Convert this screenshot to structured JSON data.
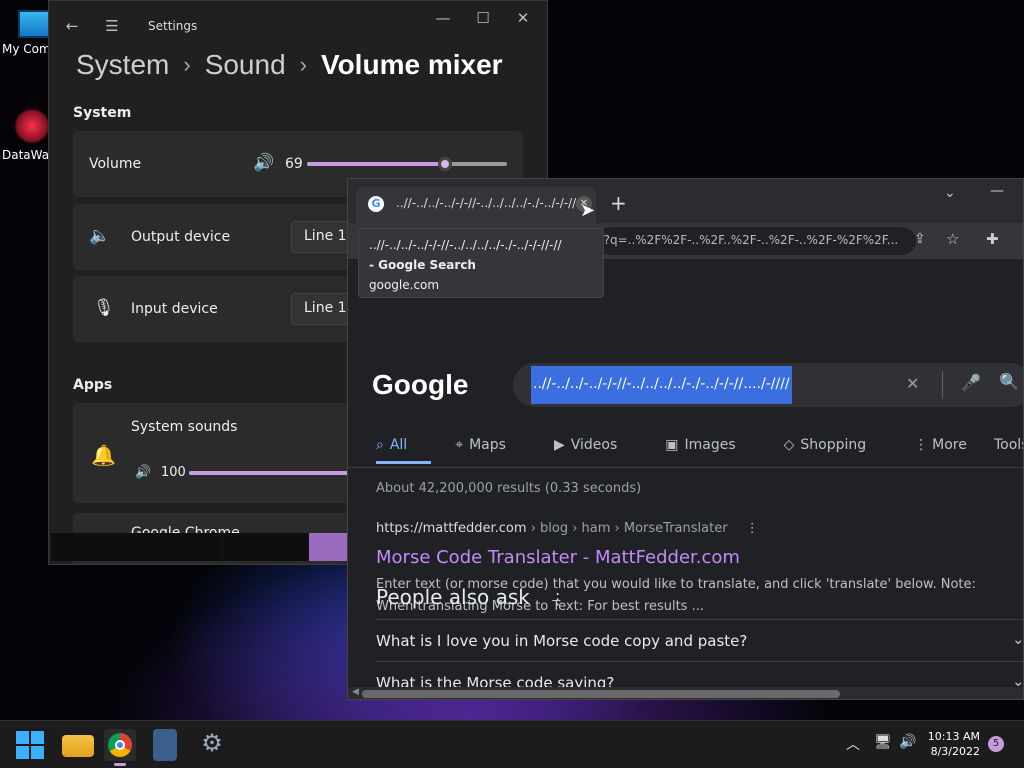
{
  "desktop": {
    "icons": [
      {
        "label": "My Com"
      },
      {
        "label": "DataWag"
      }
    ]
  },
  "settings": {
    "title": "Settings",
    "breadcrumb": [
      "System",
      "Sound",
      "Volume mixer"
    ],
    "system_heading": "System",
    "volume": {
      "label": "Volume",
      "value": "69",
      "level": 0.69
    },
    "output": {
      "label": "Output device",
      "value": "Line 1 ("
    },
    "input": {
      "label": "Input device",
      "value": "Line 1 ("
    },
    "apps_heading": "Apps",
    "system_sounds": {
      "label": "System sounds",
      "value": "100",
      "level": 1.0
    },
    "chrome_app": {
      "label": "Google Chrome"
    }
  },
  "chrome": {
    "tab_title": "..//-../../-../-/-//-../../../../-./-../-/-//..",
    "url": "n?q=..%2F%2F-..%2F..%2F-..%2F-..%2F-%2F%2F...",
    "tooltip": {
      "line1": "..//-../../-../-/-//-../../../../-./-../-/-//-//",
      "line2": "- Google Search",
      "line3": "google.com"
    },
    "logo": "Google",
    "query": "..//-../../-../-/-//-../../../../-./-../-/-//..../-////",
    "tabs": [
      "All",
      "Maps",
      "Videos",
      "Images",
      "Shopping",
      "More"
    ],
    "tools": "Tools",
    "stats": "About 42,200,000 results (0.33 seconds)",
    "result": {
      "breadcrumb": "https://mattfedder.com",
      "breadcrumb_path": " › blog › ham › MorseTranslater",
      "title": "Morse Code Translater - MattFedder.com",
      "snippet1": "Enter text (or morse code) that you would like to translate, and click 'translate' below. Note:",
      "snippet2": "When translating Morse to Text: For best results ..."
    },
    "paa_title": "People also ask",
    "paa": [
      "What is I love you in Morse code copy and paste?",
      "What is the Morse code saying?"
    ]
  },
  "taskbar": {
    "time": "10:13 AM",
    "date": "8/3/2022",
    "badge": "5"
  },
  "colors": {
    "accent": "#c89be0",
    "link": "#c58af9",
    "selection": "#3b6fe0"
  }
}
